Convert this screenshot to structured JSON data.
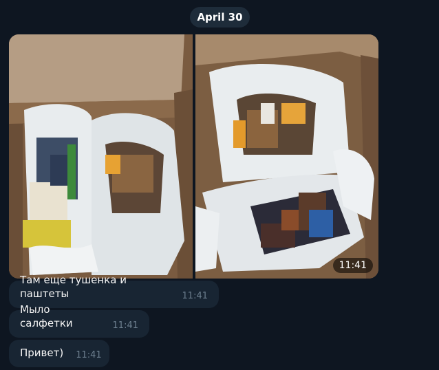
{
  "date_separator": "April 30",
  "album": {
    "time": "11:41",
    "photos": [
      {
        "icon": "groceries-box-photo"
      },
      {
        "icon": "groceries-box-photo"
      }
    ]
  },
  "messages": [
    {
      "text": "Там еще тушенка и паштеты",
      "time": "11:41"
    },
    {
      "text": "Мыло салфетки",
      "time": "11:41"
    },
    {
      "text": "Привет)",
      "time": "11:41"
    }
  ],
  "colors": {
    "background": "#0e1621",
    "bubble": "#182533",
    "date_pill": "#1e2c3a",
    "time_text": "#6d7f8f"
  }
}
